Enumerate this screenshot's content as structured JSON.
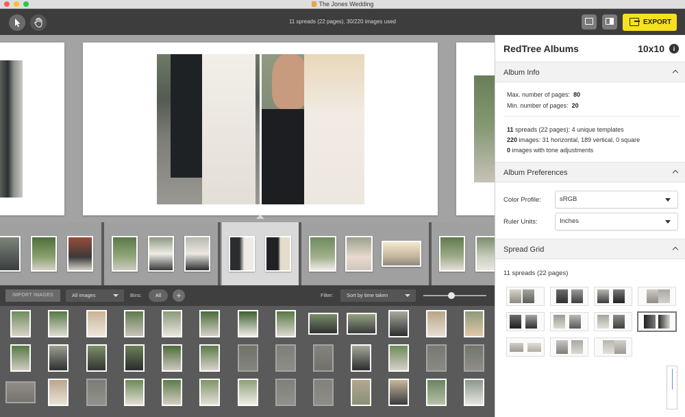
{
  "window": {
    "title": "The Jones Wedding"
  },
  "toolbar": {
    "status": "11 spreads (22 pages), 30/220 images used",
    "export_label": "EXPORT"
  },
  "bins": {
    "import_label": "IMPORT IMAGES",
    "images_select": "All images",
    "bins_label": "Bins:",
    "bin_pill": "All",
    "add_label": "+",
    "filter_label": "Filter:",
    "sort_select": "Sort by time taken",
    "thumb_size": 0.45
  },
  "panel": {
    "title": "RedTree Albums",
    "size": "10x10",
    "info_icon": "i",
    "album_info": {
      "heading": "Album Info",
      "max_label": "Max. number of pages:",
      "max_value": "80",
      "min_label": "Min. number of pages:",
      "min_value": "20",
      "spreads_count": "11",
      "spreads_text": "spreads (22 pages): 4 unique templates",
      "images_count": "220",
      "images_text": "images: 31 horizontal, 189 vertical, 0 square",
      "tone_count": "0",
      "tone_text": "images with tone adjustments"
    },
    "prefs": {
      "heading": "Album Preferences",
      "color_label": "Color Profile:",
      "color_value": "sRGB",
      "ruler_label": "Ruler Units:",
      "ruler_value": "Inches"
    },
    "spread_grid": {
      "heading": "Spread Grid",
      "summary": "11 spreads (22 pages)"
    }
  },
  "colors": {
    "export": "#f7e11e",
    "canvas": "#a3a3a3",
    "panel_bg": "#ffffff"
  },
  "icons": [
    "pointer-icon",
    "hand-icon",
    "single-page-view-icon",
    "panel-toggle-icon",
    "export-icon",
    "info-icon",
    "chevron-up-icon",
    "dropdown-caret-icon"
  ]
}
